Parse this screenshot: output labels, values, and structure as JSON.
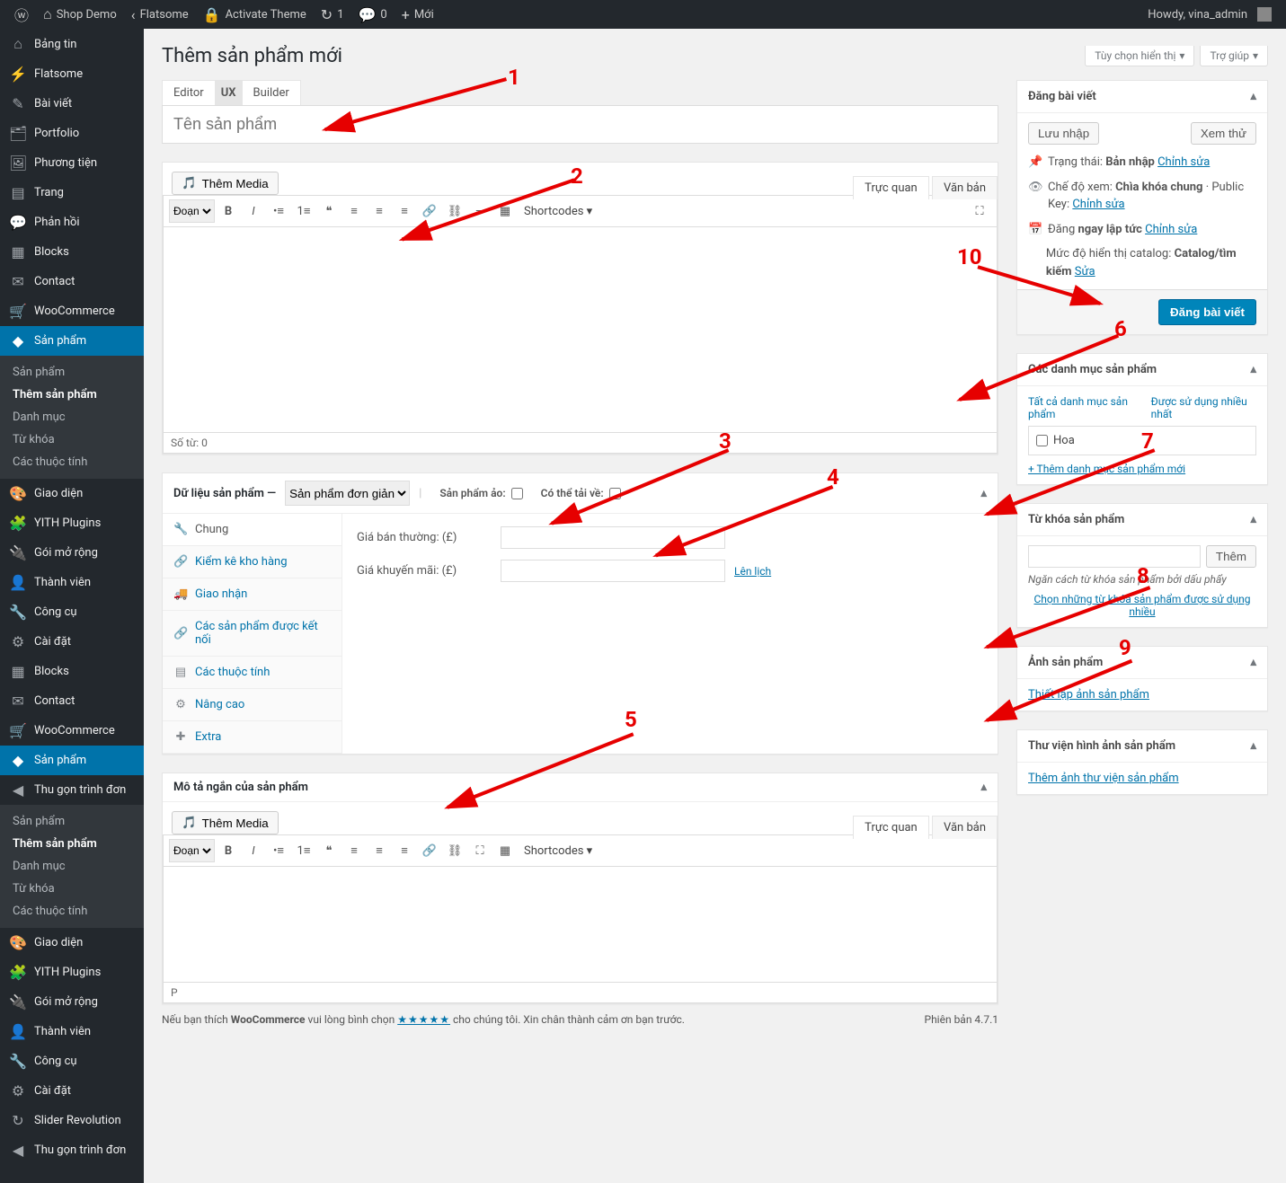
{
  "adminbar": {
    "site_name": "Shop Demo",
    "flatsome": "Flatsome",
    "activate_theme": "Activate Theme",
    "updates": "1",
    "comments": "0",
    "new": "Mới",
    "howdy": "Howdy, vina_admin"
  },
  "sidebar": {
    "items": [
      {
        "icon": "⌂",
        "label": "Bảng tin"
      },
      {
        "icon": "⚡",
        "label": "Flatsome"
      },
      {
        "icon": "✎",
        "label": "Bài viết"
      },
      {
        "icon": "🗂",
        "label": "Portfolio"
      },
      {
        "icon": "🖼",
        "label": "Phương tiện"
      },
      {
        "icon": "▤",
        "label": "Trang"
      },
      {
        "icon": "💬",
        "label": "Phản hồi"
      },
      {
        "icon": "▦",
        "label": "Blocks"
      },
      {
        "icon": "✉",
        "label": "Contact"
      },
      {
        "icon": "🛒",
        "label": "WooCommerce"
      },
      {
        "icon": "◆",
        "label": "Sản phẩm",
        "current": true
      },
      {
        "icon": "🎨",
        "label": "Giao diện"
      },
      {
        "icon": "🧩",
        "label": "YITH Plugins"
      },
      {
        "icon": "🔌",
        "label": "Gói mở rộng"
      },
      {
        "icon": "👤",
        "label": "Thành viên"
      },
      {
        "icon": "🔧",
        "label": "Công cụ"
      },
      {
        "icon": "⚙",
        "label": "Cài đặt"
      },
      {
        "icon": "▦",
        "label": "Blocks"
      },
      {
        "icon": "✉",
        "label": "Contact"
      },
      {
        "icon": "🛒",
        "label": "WooCommerce"
      },
      {
        "icon": "◆",
        "label": "Sản phẩm",
        "current": true
      },
      {
        "icon": "🎨",
        "label": "Giao diện"
      },
      {
        "icon": "🧩",
        "label": "YITH Plugins"
      },
      {
        "icon": "🔌",
        "label": "Gói mở rộng"
      },
      {
        "icon": "👤",
        "label": "Thành viên"
      },
      {
        "icon": "🔧",
        "label": "Công cụ"
      },
      {
        "icon": "⚙",
        "label": "Cài đặt"
      },
      {
        "icon": "↻",
        "label": "Slider Revolution"
      }
    ],
    "submenu": [
      "Sản phẩm",
      "Thêm sản phẩm",
      "Danh mục",
      "Từ khóa",
      "Các thuộc tính"
    ],
    "collapse": "Thu gọn trình đơn"
  },
  "page": {
    "title": "Thêm sản phẩm mới",
    "screen_options": "Tùy chọn hiển thị",
    "help": "Trợ giúp",
    "title_tabs": {
      "editor": "Editor",
      "ux": "UX",
      "builder": "Builder"
    },
    "title_placeholder": "Tên sản phẩm",
    "add_media": "Thêm Media",
    "editor_tabs": {
      "visual": "Trực quan",
      "text": "Văn bản"
    },
    "format_select": "Đoạn",
    "shortcodes": "Shortcodes",
    "word_count": "Số từ: 0",
    "short_desc_title": "Mô tả ngắn của sản phẩm",
    "short_desc_path": "P"
  },
  "product_data": {
    "title": "Dữ liệu sản phẩm —",
    "type": "Sản phẩm đơn giản",
    "virtual_label": "Sản phẩm ảo:",
    "downloadable_label": "Có thể tải về:",
    "tabs": [
      "Chung",
      "Kiểm kê kho hàng",
      "Giao nhận",
      "Các sản phẩm được kết nối",
      "Các thuộc tính",
      "Nâng cao",
      "Extra"
    ],
    "tab_icons": [
      "🔧",
      "🔗",
      "🚚",
      "🔗",
      "▤",
      "⚙",
      "✚"
    ],
    "regular_price_label": "Giá bán thường: (£)",
    "sale_price_label": "Giá khuyến mãi: (£)",
    "schedule": "Lên lịch"
  },
  "publish": {
    "title": "Đăng bài viết",
    "save_draft": "Lưu nhập",
    "preview": "Xem thử",
    "status_label": "Trạng thái:",
    "status_value": "Bản nhập",
    "edit": "Chỉnh sửa",
    "visibility_label": "Chế độ xem:",
    "visibility_value": "Chìa khóa chung",
    "visibility_extra": "· Public Key:",
    "publish_label": "Đăng",
    "publish_value": "ngay lập tức",
    "catalog_label": "Mức độ hiển thị catalog:",
    "catalog_value": "Catalog/tìm kiếm",
    "catalog_edit": "Sửa",
    "submit": "Đăng bài viết"
  },
  "categories": {
    "title": "Các danh mục sản phẩm",
    "tab_all": "Tất cả danh mục sản phẩm",
    "tab_used": "Được sử dụng nhiều nhất",
    "items": [
      "Hoa"
    ],
    "add_new": "+ Thêm danh mục sản phẩm mới"
  },
  "tags": {
    "title": "Từ khóa sản phẩm",
    "add_btn": "Thêm",
    "hint": "Ngăn cách từ khóa sản phẩm bởi dấu phẩy",
    "popular": "Chọn những từ khóa sản phẩm được sử dụng nhiều"
  },
  "image": {
    "title": "Ảnh sản phẩm",
    "set": "Thiết lập ảnh sản phẩm"
  },
  "gallery": {
    "title": "Thư viện hình ảnh sản phẩm",
    "add": "Thêm ảnh thư viện sản phẩm"
  },
  "footer": {
    "text1": "Nếu bạn thích ",
    "wc": "WooCommerce",
    "text2": " vui lòng bình chọn ",
    "stars": "★★★★★",
    "text3": " cho chúng tôi. Xin chân thành cảm ơn bạn trước.",
    "version": "Phiên bản 4.7.1"
  },
  "annotations": [
    "1",
    "2",
    "3",
    "4",
    "5",
    "6",
    "7",
    "8",
    "9",
    "10"
  ]
}
